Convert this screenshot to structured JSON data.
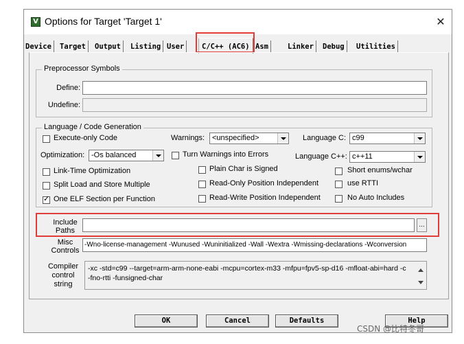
{
  "window": {
    "title": "Options for Target 'Target 1'",
    "close_glyph": "✕",
    "icon_glyph": "V"
  },
  "tabs": [
    "Device",
    "Target",
    "Output",
    "Listing",
    "User",
    "C/C++ (AC6)",
    "Asm",
    "Linker",
    "Debug",
    "Utilities"
  ],
  "active_tab": "C/C++ (AC6)",
  "preprocessor": {
    "legend": "Preprocessor Symbols",
    "define_label": "Define:",
    "define_value": "",
    "undefine_label": "Undefine:",
    "undefine_value": ""
  },
  "language": {
    "legend": "Language / Code Generation",
    "execute_only_label": "Execute-only Code",
    "execute_only_checked": false,
    "warnings_label": "Warnings:",
    "warnings_value": "<unspecified>",
    "language_c_label": "Language C:",
    "language_c_value": "c99",
    "optimization_label": "Optimization:",
    "optimization_value": "-Os balanced",
    "turn_warnings_label": "Turn Warnings into Errors",
    "turn_warnings_checked": false,
    "language_cpp_label": "Language C++:",
    "language_cpp_value": "c++11",
    "lto_label": "Link-Time Optimization",
    "lto_checked": false,
    "plain_char_label": "Plain Char is Signed",
    "plain_char_checked": false,
    "short_enums_label": "Short enums/wchar",
    "short_enums_checked": false,
    "split_load_label": "Split Load and Store Multiple",
    "split_load_checked": false,
    "ropi_label": "Read-Only Position Independent",
    "ropi_checked": false,
    "rtti_label": "use RTTI",
    "rtti_checked": false,
    "one_elf_label": "One ELF Section per Function",
    "one_elf_checked": true,
    "rwpi_label": "Read-Write Position Independent",
    "rwpi_checked": false,
    "no_auto_label": "No Auto Includes",
    "no_auto_checked": false
  },
  "include_paths": {
    "label_line1": "Include",
    "label_line2": "Paths",
    "value": "",
    "browse_label": "..."
  },
  "misc_controls": {
    "label_line1": "Misc",
    "label_line2": "Controls",
    "value": "-Wno-license-management -Wunused -Wuninitialized -Wall -Wextra -Wmissing-declarations -Wconversion"
  },
  "compiler_control": {
    "label_line1": "Compiler",
    "label_line2": "control",
    "label_line3": "string",
    "line1": "-xc -std=c99 --target=arm-arm-none-eabi -mcpu=cortex-m33 -mfpu=fpv5-sp-d16 -mfloat-abi=hard -c",
    "line2": "-fno-rtti -funsigned-char"
  },
  "buttons": {
    "ok": "OK",
    "cancel": "Cancel",
    "defaults": "Defaults",
    "help": "Help"
  },
  "watermark": "CSDN @比特冬哥",
  "colors": {
    "highlight": "#e03c3c",
    "dialog_bg": "#f0f0f0"
  }
}
